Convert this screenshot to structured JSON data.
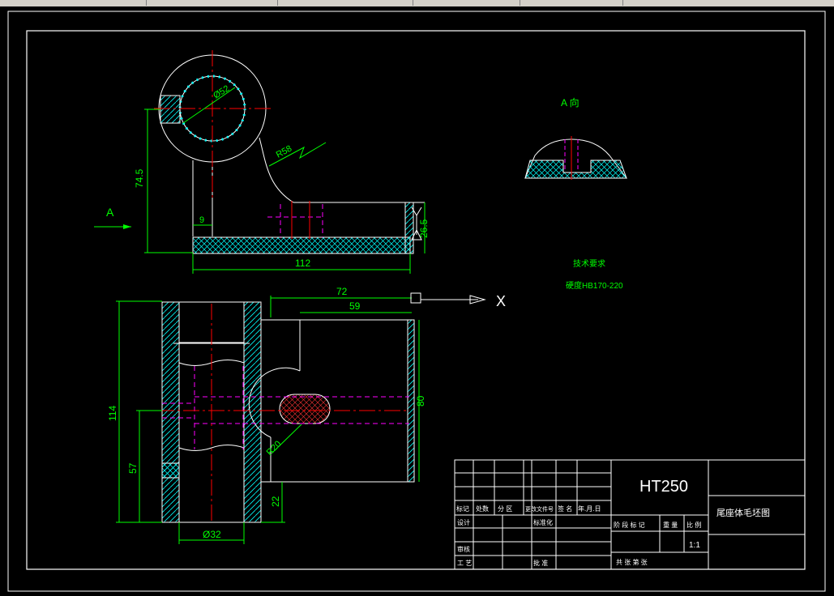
{
  "drawing": {
    "dimensions": {
      "phi52": "Ø52",
      "r58": "R58",
      "h745": "74.5",
      "w9": "9",
      "w112": "112",
      "h265": "26.5",
      "w72": "72",
      "w59": "59",
      "h114": "114",
      "h57": "57",
      "h80": "80",
      "r20": "R20",
      "h22": "22",
      "phi32": "Ø32"
    },
    "view_arrow_label": "A",
    "view_a_title": "A 向",
    "tech_req_title": "技术要求",
    "tech_req_text": "硬度HB170-220",
    "ucs_x": "X"
  },
  "title_block": {
    "material": "HT250",
    "part_name": "尾座体毛坯图",
    "scale": "1:1",
    "row_labels": {
      "mark": "标记",
      "count": "处数",
      "zone": "分 区",
      "doc_no": "更改文件号",
      "sign": "签 名",
      "date": "年.月.日",
      "design": "设计",
      "std": "标准化",
      "review": "审核",
      "craft": "工 艺",
      "approve": "批 准",
      "stage_mark": "阶 段 标 记",
      "weight": "重 量",
      "ratio": "比 例",
      "sheets": "共     张  第     张"
    }
  },
  "colors": {
    "background": "#000000",
    "outline": "#ffffff",
    "dimension": "#00ff00",
    "centerline": "#ff0000",
    "hidden": "#ff00ff",
    "hatch": "#00ffff"
  }
}
